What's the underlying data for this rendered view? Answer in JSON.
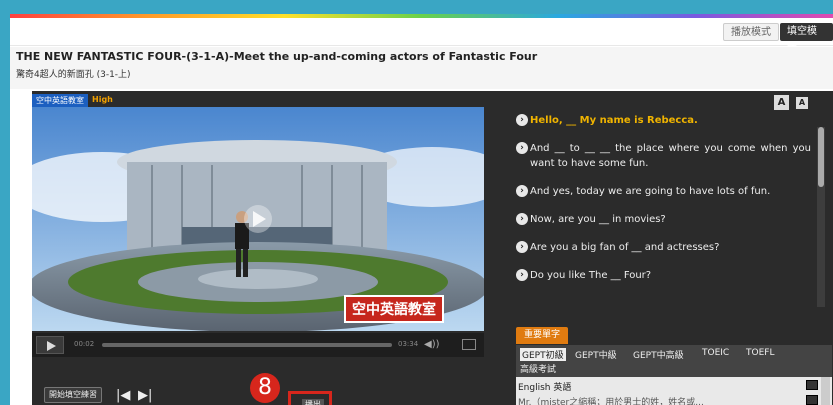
{
  "mode": {
    "play_label": "播放模式",
    "fill_label": "填空模式"
  },
  "title": {
    "english": "THE NEW FANTASTIC FOUR-(3-1-A)-Meet the up-and-coming actors of Fantastic Four",
    "chinese": "驚奇4超人的新面孔 (3-1-上)"
  },
  "video": {
    "tab_label": "空中英語教室",
    "quality_label": "High",
    "brand_overlay": "空中英語教室",
    "current_time": "00:02",
    "total_time": "03:34"
  },
  "controls": {
    "practice_label": "開始填空練習",
    "prev_icon": "skip-back-icon",
    "next_icon": "skip-forward-icon"
  },
  "annotation": {
    "step_number": "8",
    "output_label": "播出"
  },
  "font_buttons": {
    "large": "A",
    "small": "A"
  },
  "script_lines": [
    "Hello, __ My name is Rebecca.",
    "And __ to __ __ the place where you come when you want to have some fun.",
    "And yes, today we are going to have lots of fun.",
    "Now, are you __ in movies?",
    "Are you a big fan of __ and actresses?",
    "Do you like The __ Four?"
  ],
  "current_line_index": 0,
  "vocab": {
    "section_label": "重要單字",
    "tabs": [
      "GEPT初級",
      "GEPT中級",
      "GEPT中高級",
      "TOEIC",
      "TOEFL",
      "高級考試"
    ],
    "selected_tab": 0,
    "rows": [
      {
        "text": "English 英語"
      },
      {
        "text": "Mr.（mister之縮稱；用於男士的姓，姓名或..."
      }
    ]
  },
  "colors": {
    "accent_orange": "#f0b400",
    "step_red": "#d7261c",
    "panel_dark": "#2b2b2b",
    "page_blue": "#3aa6c4"
  }
}
